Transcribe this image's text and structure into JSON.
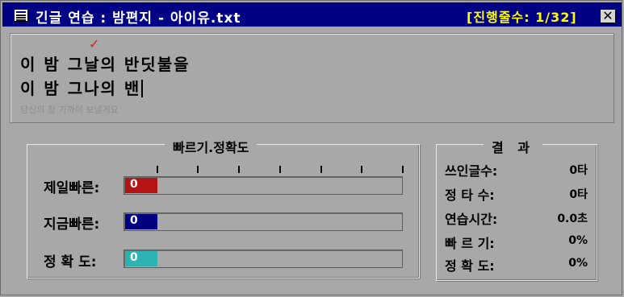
{
  "title": {
    "text": "긴글 연습 : 밤편지 - 아이유.txt",
    "progress": "[진행줄수: 1/32]",
    "close_label": "✕"
  },
  "typing": {
    "check_mark": "✓",
    "source_line": "이 밤 그날의 반딧불을",
    "typed_line": "이 밤 그나의 밴",
    "next_line": "당신의 창 가까이 보낼게요"
  },
  "speed_panel": {
    "title": "빠르기.정확도",
    "gauges": [
      {
        "label": "제일빠른:",
        "value": "0",
        "fraction": 0,
        "color": "#b51414"
      },
      {
        "label": "지금빠른:",
        "value": "0",
        "fraction": 0,
        "color": "#000080"
      },
      {
        "label": "정 확 도:",
        "value": "0",
        "fraction": 0,
        "color": "#2eb3b3"
      }
    ]
  },
  "result_panel": {
    "title": "결 과",
    "rows": [
      {
        "label": "쓰인글수:",
        "value": "0타"
      },
      {
        "label": "정 타 수:",
        "value": "0타"
      },
      {
        "label": "연습시간:",
        "value": "0.0초"
      },
      {
        "label": "빠 르 기:",
        "value": "0%"
      },
      {
        "label": "정 확 도:",
        "value": "0%"
      }
    ]
  }
}
